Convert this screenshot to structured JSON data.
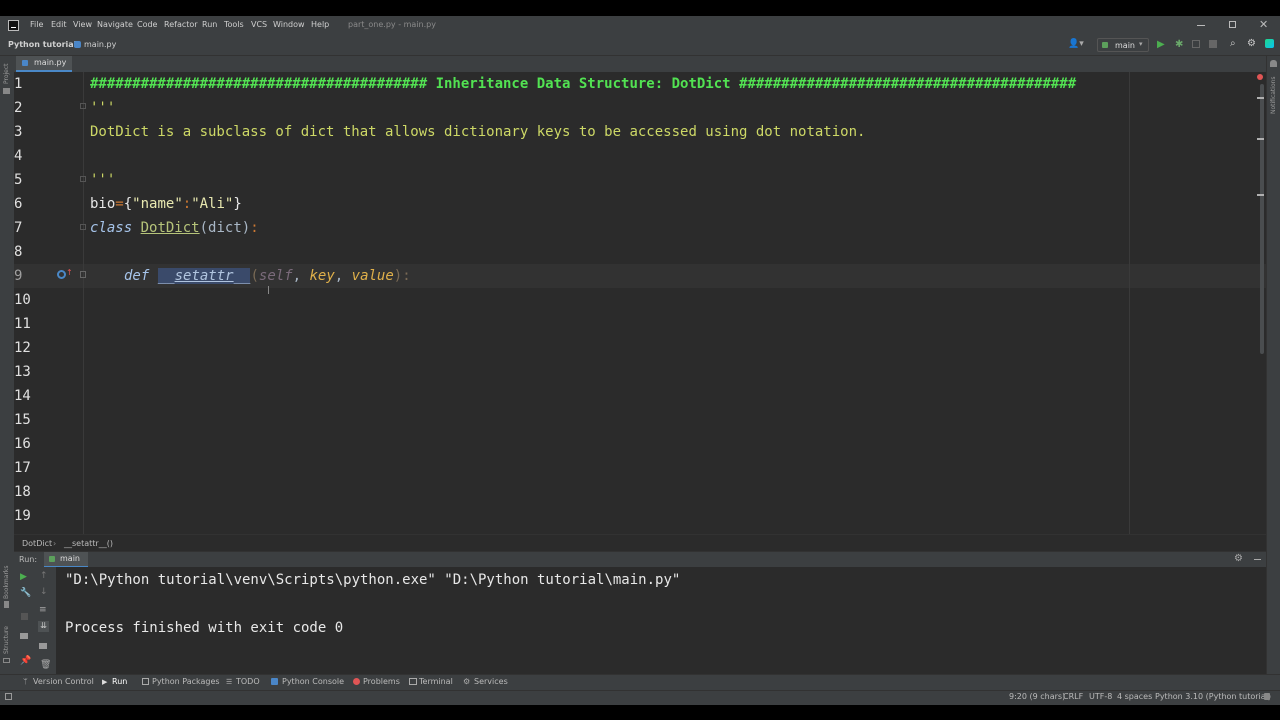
{
  "window": {
    "menus": [
      "File",
      "Edit",
      "View",
      "Navigate",
      "Code",
      "Refactor",
      "Run",
      "Tools",
      "VCS",
      "Window",
      "Help"
    ],
    "title": "part_one.py - main.py"
  },
  "navbar": {
    "project": "Python tutorial",
    "file": "main.py",
    "run_config": "main"
  },
  "editor": {
    "tab": "main.py",
    "line_numbers": [
      "1",
      "2",
      "3",
      "4",
      "5",
      "6",
      "7",
      "8",
      "9",
      "10",
      "11",
      "12",
      "13",
      "14",
      "15",
      "16",
      "17",
      "18",
      "19"
    ],
    "lines": {
      "l1": "######################################## Inheritance Data Structure: DotDict ########################################",
      "l2": "'''",
      "l3": "DotDict is a subclass of dict that allows dictionary keys to be accessed using dot notation.",
      "l5": "'''",
      "l6_var": "bio",
      "l6_eq": "=",
      "l6_open": "{",
      "l6_key": "\"name\"",
      "l6_colon": ":",
      "l6_val": "\"Ali\"",
      "l6_close": "}",
      "l7_kw": "class",
      "l7_name": "DotDict",
      "l7_base": "(dict)",
      "l7_colon": ":",
      "l9_def": "def",
      "l9_pre": "__",
      "l9_name": "setattr",
      "l9_post": "__",
      "l9_open": "(",
      "l9_self": "self",
      "l9_comma1": ", ",
      "l9_key": "key",
      "l9_comma2": ", ",
      "l9_value": "value",
      "l9_close": ")",
      "l9_colon": ":"
    },
    "breadcrumb": [
      "DotDict",
      "__setattr__()"
    ]
  },
  "run_panel": {
    "label": "Run:",
    "tab": "main",
    "command": "\"D:\\Python tutorial\\venv\\Scripts\\python.exe\" \"D:\\Python tutorial\\main.py\"",
    "result": "Process finished with exit code 0"
  },
  "side_labels": {
    "project": "Project",
    "bookmarks": "Bookmarks",
    "structure": "Structure",
    "notifications": "Notifications"
  },
  "tool_windows": [
    "Version Control",
    "Run",
    "Python Packages",
    "TODO",
    "Python Console",
    "Problems",
    "Terminal",
    "Services"
  ],
  "status": {
    "position": "9:20 (9 chars)",
    "line_sep": "CRLF",
    "encoding": "UTF-8",
    "indent": "4 spaces",
    "interpreter": "Python 3.10 (Python tutorial)"
  },
  "colors": {
    "editor_bg": "#2b2b2b",
    "chrome_bg": "#3c3f41",
    "hash_comment": "#52e252",
    "docstring": "#cdd866",
    "keyword": "#cc7832",
    "run_green": "#4caf50"
  }
}
